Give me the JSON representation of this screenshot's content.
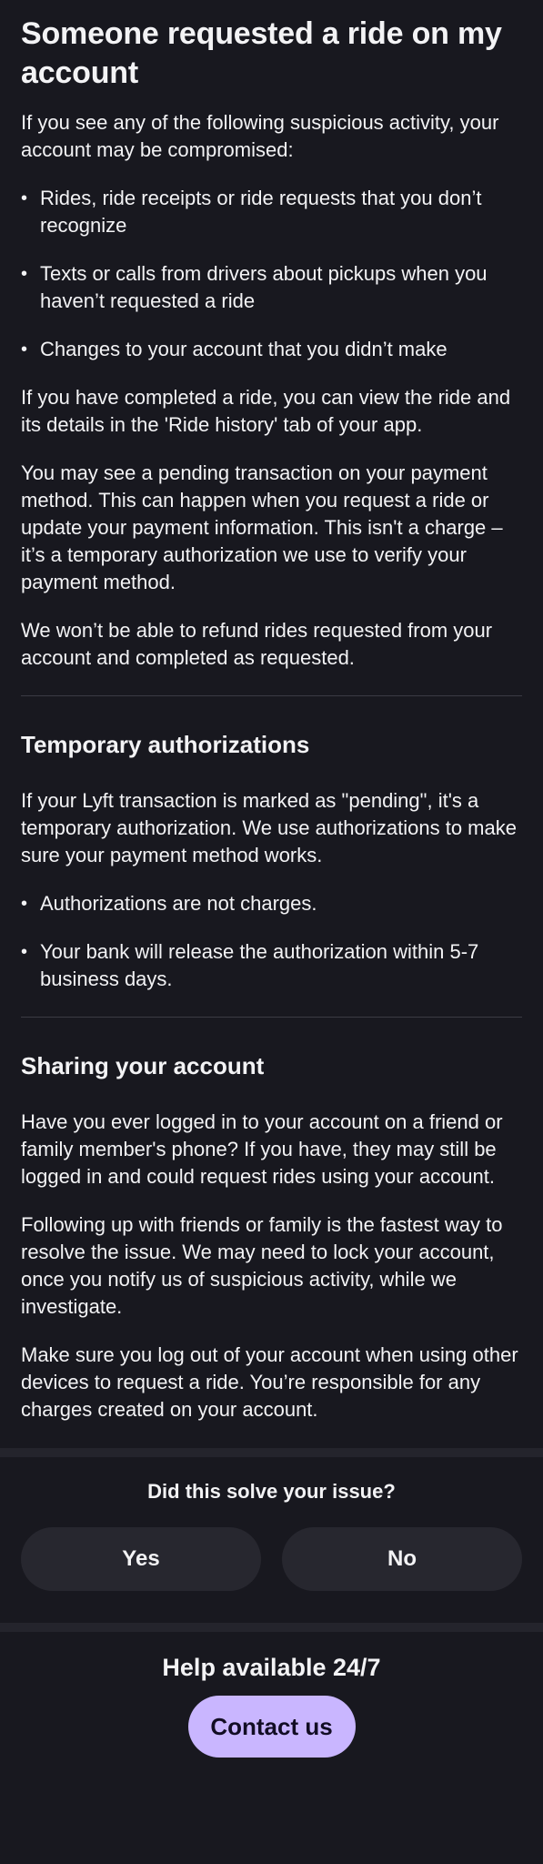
{
  "article": {
    "title": "Someone requested a ride on my account",
    "intro": "If you see any of the following suspicious activity, your account may be compromised:",
    "bullets": [
      "Rides, ride receipts or ride requests that you don’t recognize",
      "Texts or calls from drivers about pickups when you haven’t requested a ride",
      "Changes to your account that you didn’t make"
    ],
    "paragraphs": [
      "If you have completed a ride, you can view the ride and its details in the 'Ride history' tab of your app.",
      "You may see a pending transaction on your payment method. This can happen when you request a ride or update your payment information. This isn't a charge – it’s a temporary authorization we use to verify your payment method.",
      "We won’t be able to refund rides requested from your account and completed as requested."
    ]
  },
  "temp_auth": {
    "title": "Temporary authorizations",
    "body": "If your Lyft transaction is marked as \"pending\", it's a temporary authorization. We use authorizations to make sure your payment method works.",
    "bullets": [
      "Authorizations are not charges.",
      "Your bank will release the authorization within 5-7 business days."
    ]
  },
  "sharing": {
    "title": "Sharing your account",
    "paragraphs": [
      "Have you ever logged in to your account on a friend or family member's phone? If you have, they may still be logged in and could request rides using your account.",
      "Following up with friends or family is the fastest way to resolve the issue. We may need to lock your account, once you notify us of suspicious activity, while we investigate.",
      "Make sure you log out of your account when using other devices to request a ride. You’re responsible for any charges created on your account."
    ]
  },
  "feedback": {
    "question": "Did this solve your issue?",
    "yes_label": "Yes",
    "no_label": "No"
  },
  "help": {
    "title": "Help available 24/7",
    "contact_label": "Contact us"
  },
  "colors": {
    "background": "#18181f",
    "text": "#f3f3f5",
    "button_bg": "#27272f",
    "accent": "#c9b6ff",
    "divider": "#3b3b44"
  }
}
